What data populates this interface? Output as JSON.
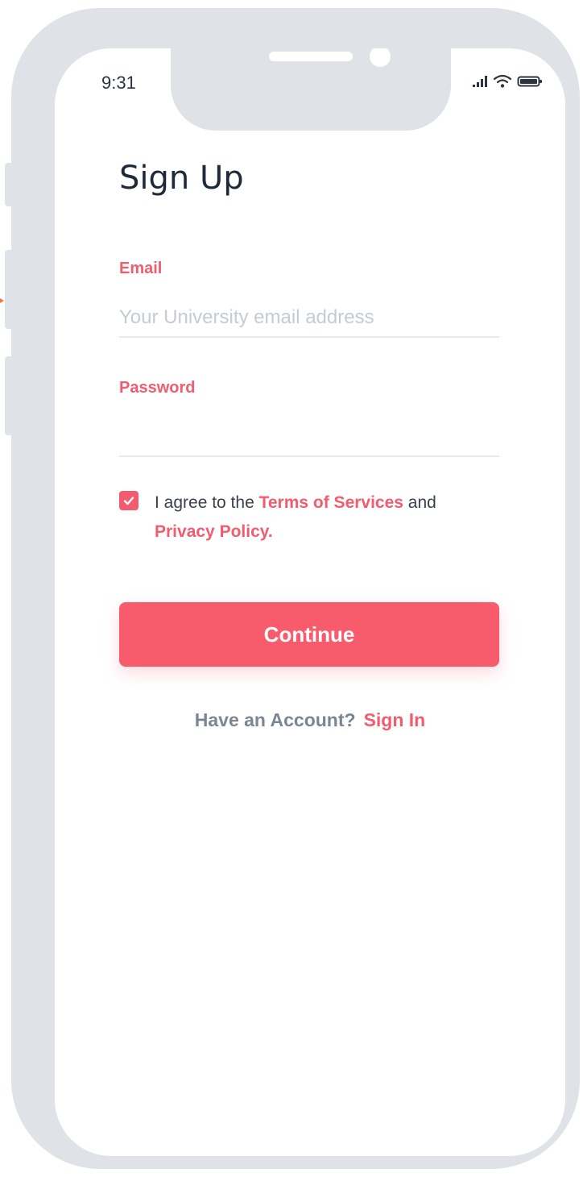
{
  "status_bar": {
    "time": "9:31",
    "icons": [
      "signal-icon",
      "wifi-icon",
      "battery-icon"
    ]
  },
  "page": {
    "title": "Sign Up"
  },
  "form": {
    "email": {
      "label": "Email",
      "placeholder": "Your University email address",
      "value": ""
    },
    "password": {
      "label": "Password",
      "value": ""
    }
  },
  "agreement": {
    "checked": true,
    "prefix": "I agree to the ",
    "terms_link": "Terms of Services",
    "middle": " and",
    "privacy_link": "Privacy Policy."
  },
  "actions": {
    "continue_label": "Continue"
  },
  "signin": {
    "prompt": "Have an Account?",
    "link": "Sign In"
  },
  "colors": {
    "accent": "#f25c6e",
    "button": "#f85c6c",
    "frame": "#dfe3e8",
    "title": "#1f2a38",
    "muted": "#7b8594",
    "placeholder": "#c5cbd3"
  }
}
